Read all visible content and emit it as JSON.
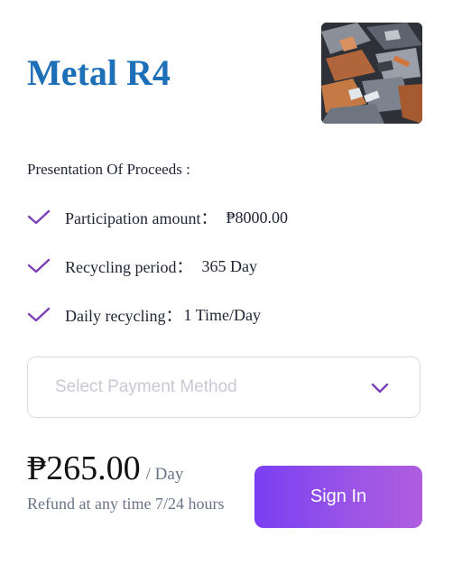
{
  "product": {
    "title": "Metal R4",
    "image_icon": "scrap-metal-image"
  },
  "proceeds": {
    "heading": "Presentation Of Proceeds :",
    "items": [
      {
        "icon": "check-icon",
        "label": "Participation amount：",
        "value": "₱8000.00"
      },
      {
        "icon": "check-icon",
        "label": "Recycling period：",
        "value": "365 Day"
      },
      {
        "icon": "check-icon",
        "label": "Daily recycling：",
        "value": "1 Time/Day"
      }
    ]
  },
  "payment": {
    "placeholder": "Select Payment Method",
    "icon": "chevron-down-icon"
  },
  "pricing": {
    "amount": "₱265.00",
    "unit": "/ Day",
    "refund_note": "Refund at any time 7/24 hours"
  },
  "actions": {
    "sign_in_label": "Sign In"
  },
  "colors": {
    "title": "#1d6fb8",
    "check": "#7b3fb8",
    "button_start": "#7a3ff2",
    "button_end": "#b05ddf"
  }
}
